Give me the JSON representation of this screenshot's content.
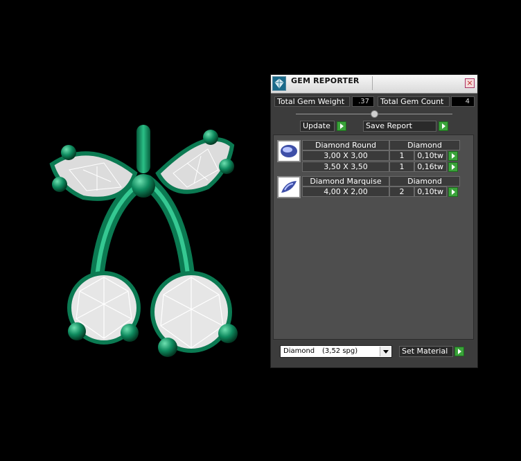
{
  "window": {
    "title": "GEM REPORTER",
    "close_label": "×"
  },
  "summary": {
    "weight_label": "Total Gem Weight",
    "weight_value": ".37",
    "count_label": "Total Gem Count",
    "count_value": "4"
  },
  "toolbar": {
    "update_label": "Update",
    "save_label": "Save Report"
  },
  "gem_groups": [
    {
      "gem_type": "Diamond Round",
      "material": "Diamond",
      "icon": "round-gem-icon",
      "rows": [
        {
          "size": "3,00 X 3,00",
          "count": "1",
          "weight": "0,10tw"
        },
        {
          "size": "3,50 X 3,50",
          "count": "1",
          "weight": "0,16tw"
        }
      ]
    },
    {
      "gem_type": "Diamond Marquise",
      "material": "Diamond",
      "icon": "marquise-gem-icon",
      "rows": [
        {
          "size": "4,00 X 2,00",
          "count": "2",
          "weight": "0,10tw"
        }
      ]
    }
  ],
  "material_select": {
    "name": "Diamond",
    "spg": "(3,52 spg)"
  },
  "set_material_label": "Set Material",
  "colors": {
    "metal": "#0e8a5e",
    "gem": "#e8e8e8",
    "panel": "#3c3c3c",
    "accent_green": "#3aa33a"
  }
}
